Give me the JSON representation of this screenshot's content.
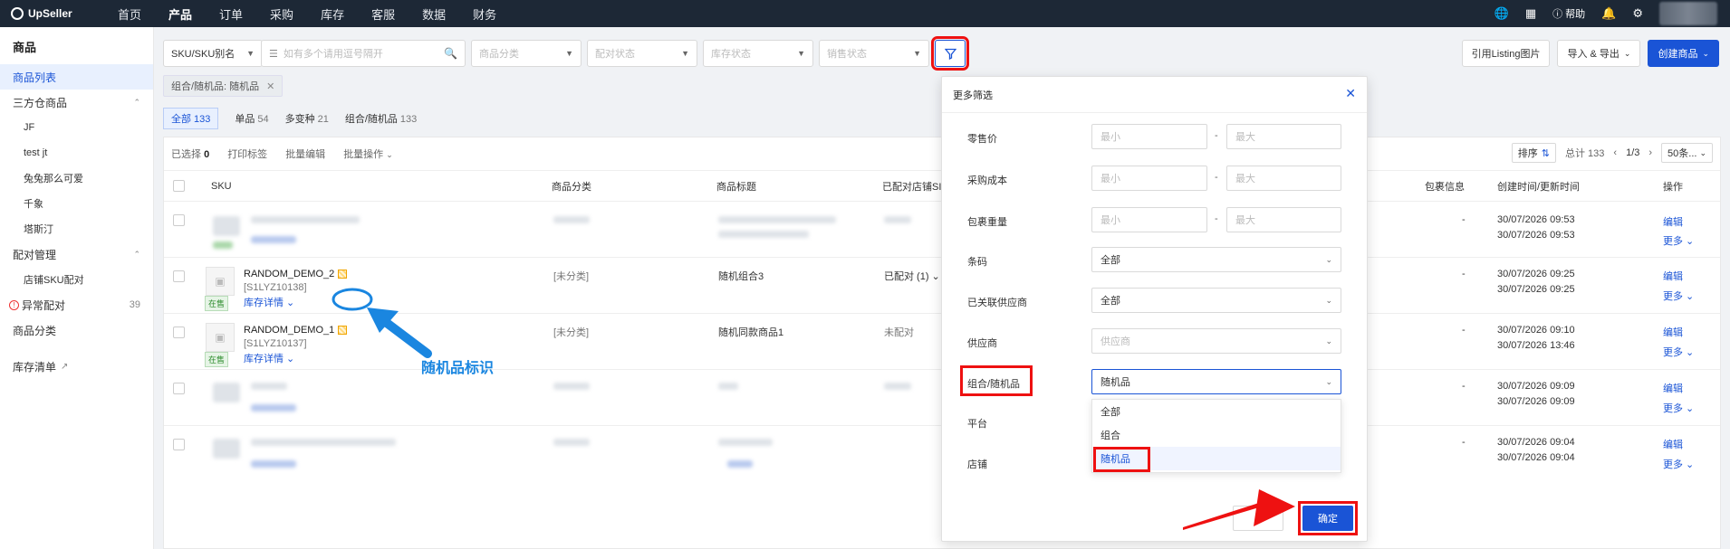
{
  "nav": {
    "brand": "UpSeller",
    "items": [
      "首页",
      "产品",
      "订单",
      "采购",
      "库存",
      "客服",
      "数据",
      "财务"
    ],
    "active_index": 1,
    "help": "帮助"
  },
  "sidebar": {
    "title": "商品",
    "items": [
      {
        "label": "商品列表",
        "active": true
      },
      {
        "label": "三方仓商品"
      },
      {
        "label": "JF"
      },
      {
        "label": "test jt"
      },
      {
        "label": "兔兔那么可爱"
      },
      {
        "label": "千象"
      },
      {
        "label": "塔斯汀"
      },
      {
        "label": "配对管理"
      },
      {
        "label": "店铺SKU配对"
      },
      {
        "label": "异常配对",
        "count": "39"
      },
      {
        "label": "商品分类"
      },
      {
        "label": "库存清单"
      }
    ]
  },
  "filters": {
    "sku_type": "SKU/SKU别名",
    "search_placeholder": "如有多个请用逗号隔开",
    "category": "商品分类",
    "pair_status": "配对状态",
    "stock_status": "库存状态",
    "sale_status": "销售状态"
  },
  "actions": {
    "cite_listing": "引用Listing图片",
    "import_export": "导入 & 导出",
    "create": "创建商品"
  },
  "chip": {
    "label": "组合/随机品: 随机品"
  },
  "tabs": [
    {
      "label": "全部",
      "count": "133"
    },
    {
      "label": "单品",
      "count": "54"
    },
    {
      "label": "多变种",
      "count": "21"
    },
    {
      "label": "组合/随机品",
      "count": "133"
    }
  ],
  "toolbar": {
    "selected_prefix": "已选择",
    "selected_count": "0",
    "print": "打印标签",
    "batch_edit": "批量编辑",
    "batch_op": "批量操作",
    "sort": "排序",
    "total": "总计 133",
    "page": "1/3",
    "page_size": "50条..."
  },
  "columns": {
    "sku": "SKU",
    "category": "商品分类",
    "title": "商品标题",
    "paired": "已配对店铺SI",
    "package": "包裹信息",
    "time": "创建时间/更新时间",
    "op": "操作"
  },
  "rows": [
    {
      "blurred": true,
      "package": "-",
      "created": "30/07/2026 09:53",
      "updated": "30/07/2026 09:53"
    },
    {
      "sku": "RANDOM_DEMO_2",
      "code": "[S1LYZ10138]",
      "status": "在售",
      "stock_link": "库存详情",
      "category": "[未分类]",
      "title": "随机组合3",
      "paired": "已配对 (1)",
      "package": "-",
      "created": "30/07/2026 09:25",
      "updated": "30/07/2026 09:25"
    },
    {
      "sku": "RANDOM_DEMO_1",
      "code": "[S1LYZ10137]",
      "status": "在售",
      "stock_link": "库存详情",
      "category": "[未分类]",
      "title": "随机同款商品1",
      "paired": "未配对",
      "package": "-",
      "created": "30/07/2026 09:10",
      "updated": "30/07/2026 13:46"
    },
    {
      "blurred": true,
      "package": "-",
      "created": "30/07/2026 09:09",
      "updated": "30/07/2026 09:09"
    },
    {
      "blurred": true,
      "package": "-",
      "created": "30/07/2026 09:04",
      "updated": "30/07/2026 09:04"
    }
  ],
  "row_actions": {
    "edit": "编辑",
    "more": "更多"
  },
  "annotation": "随机品标识",
  "modal": {
    "title": "更多筛选",
    "fields": {
      "retail_price": "零售价",
      "purchase_cost": "采购成本",
      "package_weight": "包裹重量",
      "barcode": "条码",
      "linked_supplier": "已关联供应商",
      "supplier": "供应商",
      "combo_random": "组合/随机品",
      "platform": "平台",
      "shop": "店铺"
    },
    "min_placeholder": "最小",
    "max_placeholder": "最大",
    "barcode_value": "全部",
    "linked_supplier_value": "全部",
    "supplier_placeholder": "供应商",
    "combo_value": "随机品",
    "dropdown_options": [
      "全部",
      "组合",
      "随机品"
    ],
    "confirm": "确定"
  },
  "colors": {
    "accent": "#1a54d6",
    "nav_bg": "#1d2836",
    "highlight": "#e11",
    "annotation": "#1a86e0"
  }
}
